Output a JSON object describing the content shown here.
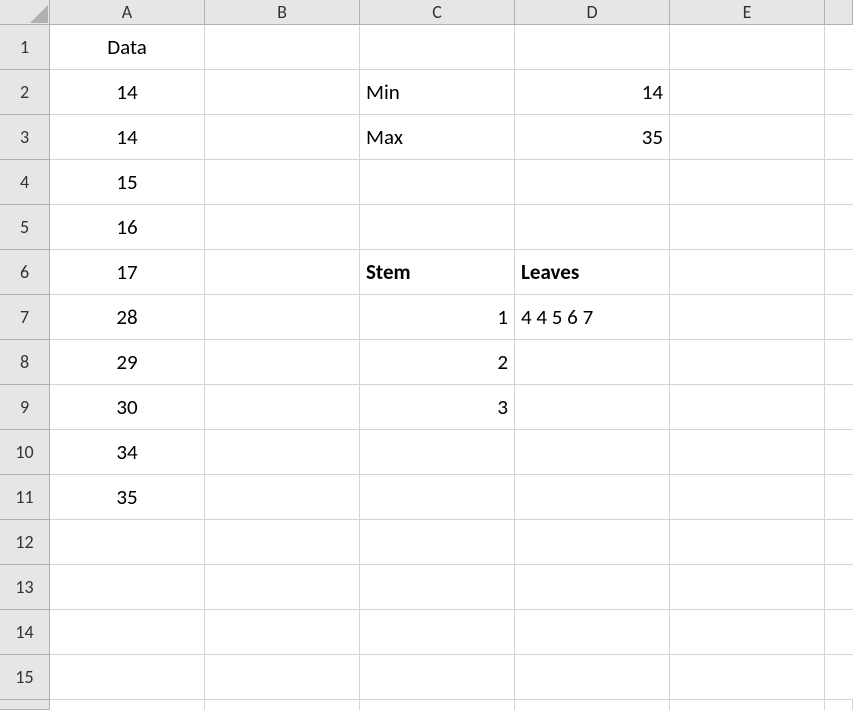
{
  "columns": [
    "A",
    "B",
    "C",
    "D",
    "E"
  ],
  "rows": [
    "1",
    "2",
    "3",
    "4",
    "5",
    "6",
    "7",
    "8",
    "9",
    "10",
    "11",
    "12",
    "13",
    "14",
    "15"
  ],
  "cells": {
    "A1": {
      "v": "Data",
      "align": "center"
    },
    "A2": {
      "v": "14",
      "align": "center"
    },
    "A3": {
      "v": "14",
      "align": "center"
    },
    "A4": {
      "v": "15",
      "align": "center"
    },
    "A5": {
      "v": "16",
      "align": "center"
    },
    "A6": {
      "v": "17",
      "align": "center"
    },
    "A7": {
      "v": "28",
      "align": "center"
    },
    "A8": {
      "v": "29",
      "align": "center"
    },
    "A9": {
      "v": "30",
      "align": "center"
    },
    "A10": {
      "v": "34",
      "align": "center"
    },
    "A11": {
      "v": "35",
      "align": "center"
    },
    "C2": {
      "v": "Min",
      "align": "left"
    },
    "C3": {
      "v": "Max",
      "align": "left"
    },
    "C6": {
      "v": "Stem",
      "align": "left",
      "bold": true
    },
    "C7": {
      "v": "1",
      "align": "right"
    },
    "C8": {
      "v": "2",
      "align": "right"
    },
    "C9": {
      "v": "3",
      "align": "right"
    },
    "D2": {
      "v": "14",
      "align": "right"
    },
    "D3": {
      "v": "35",
      "align": "right"
    },
    "D6": {
      "v": "Leaves",
      "align": "left",
      "bold": true
    },
    "D7": {
      "v": "4 4 5 6 7",
      "align": "left",
      "spaced": false
    }
  },
  "chart_data": {
    "type": "table",
    "title": "Stem-and-leaf data worksheet",
    "data_column": {
      "header": "Data",
      "values": [
        14,
        14,
        15,
        16,
        17,
        28,
        29,
        30,
        34,
        35
      ]
    },
    "summary": {
      "Min": 14,
      "Max": 35
    },
    "stem_leaf": {
      "header": [
        "Stem",
        "Leaves"
      ],
      "rows": [
        {
          "stem": 1,
          "leaves": [
            4,
            4,
            5,
            6,
            7
          ]
        },
        {
          "stem": 2,
          "leaves": []
        },
        {
          "stem": 3,
          "leaves": []
        }
      ]
    }
  }
}
